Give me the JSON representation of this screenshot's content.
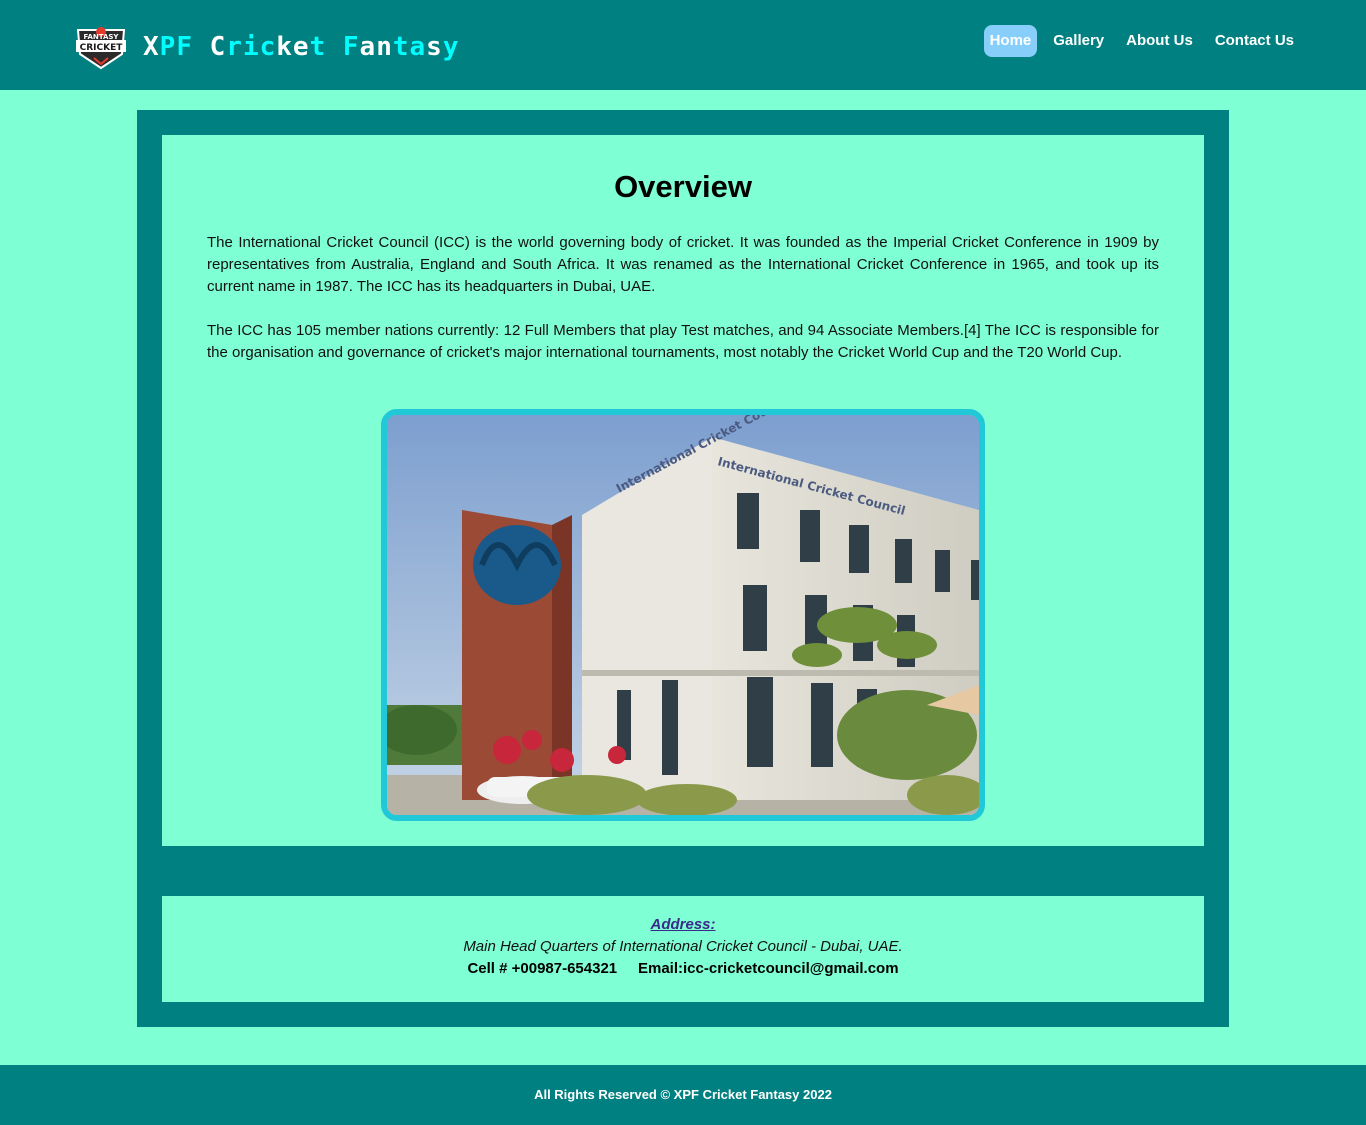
{
  "header": {
    "brand": "XPF Cricket Fantasy",
    "logo_text_top": "FANTASY",
    "logo_text_bottom": "CRICKET",
    "nav": [
      {
        "label": "Home",
        "active": true
      },
      {
        "label": "Gallery",
        "active": false
      },
      {
        "label": "About Us",
        "active": false
      },
      {
        "label": "Contact Us",
        "active": false
      }
    ]
  },
  "main": {
    "title": "Overview",
    "paragraph1": "The International Cricket Council (ICC) is the world governing body of cricket. It was founded as the Imperial Cricket Conference in 1909 by representatives from Australia, England and South Africa. It was renamed as the International Cricket Conference in 1965, and took up its current name in 1987. The ICC has its headquarters in Dubai, UAE.",
    "paragraph2": "The ICC has 105 member nations currently: 12 Full Members that play Test matches, and 94 Associate Members.[4] The ICC is responsible for the organisation and governance of cricket's major international tournaments, most notably the Cricket World Cup and the T20 World Cup.",
    "image_alt": "ICC headquarters building",
    "building_sign": "International Cricket Council"
  },
  "address": {
    "title": "Address:",
    "line": "Main Head Quarters of International Cricket Council - Dubai, UAE.",
    "cell": "Cell # +00987-654321",
    "email": "Email:icc-cricketcouncil@gmail.com"
  },
  "footer": {
    "text": "All Rights Reserved © XPF Cricket Fantasy 2022"
  },
  "colors": {
    "header_bg": "#008080",
    "page_bg": "#7fffd4",
    "nav_active": "#87cefa",
    "brand_accent": "#00ffff",
    "image_border": "#20c8d8"
  }
}
